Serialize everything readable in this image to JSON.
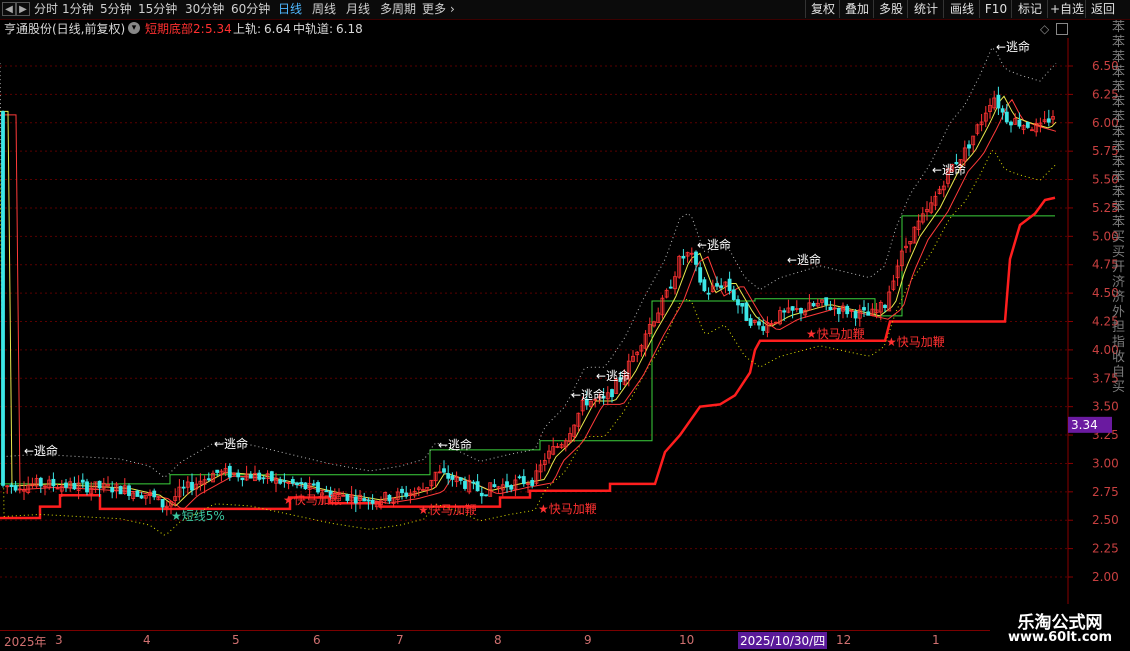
{
  "toolbar": {
    "periods": [
      "分时",
      "1分钟",
      "5分钟",
      "15分钟",
      "30分钟",
      "60分钟",
      "日线",
      "周线",
      "月线",
      "多周期",
      "更多"
    ],
    "active_period": "日线",
    "buttons": [
      "复权",
      "叠加",
      "多股",
      "统计",
      "画线",
      "F10",
      "标记",
      "+自选",
      "返回"
    ]
  },
  "info": {
    "stock": "亨通股份(日线,前复权)",
    "indicator_label": "短期底部2:",
    "indicator_value": "5.34",
    "upper_label": "上轨:",
    "upper_value": "6.64",
    "mid_label": "中轨道:",
    "mid_value": "6.18"
  },
  "annotations": {
    "escape": "←逃命",
    "horse": "★快马加鞭",
    "short": "★短线5%"
  },
  "price_axis": {
    "ticks": [
      "6.50",
      "6.25",
      "6.00",
      "5.75",
      "5.50",
      "5.25",
      "5.00",
      "4.75",
      "4.50",
      "4.25",
      "4.00",
      "3.75",
      "3.50",
      "3.25",
      "3.00",
      "2.75",
      "2.50",
      "2.25",
      "2.00"
    ],
    "current_label": "3.34"
  },
  "time_axis": {
    "labels": [
      "2025年",
      "3",
      "4",
      "5",
      "6",
      "7",
      "8",
      "9",
      "10",
      "2025/10/30/四",
      "12",
      "1"
    ]
  },
  "right_panel_text": "苯苯苯苯苯苯苯苯苯苯苯苯苯苯买买开济济外担指收自买",
  "watermark": {
    "title": "乐淘公式网",
    "url": "www.60lt.com"
  },
  "colors": {
    "up": "#ff3232",
    "down": "#3ce6e6",
    "ma_yellow": "#e8e84c",
    "ma_red": "#ff3a3a",
    "support_red": "#ff1e1e",
    "band_green": "#3cd23c",
    "dotted_white": "#bbbbbb",
    "dotted_yellow": "#e0e000",
    "active_tab": "#4fb8ff",
    "current_price_bg": "#6a1aa0"
  }
}
